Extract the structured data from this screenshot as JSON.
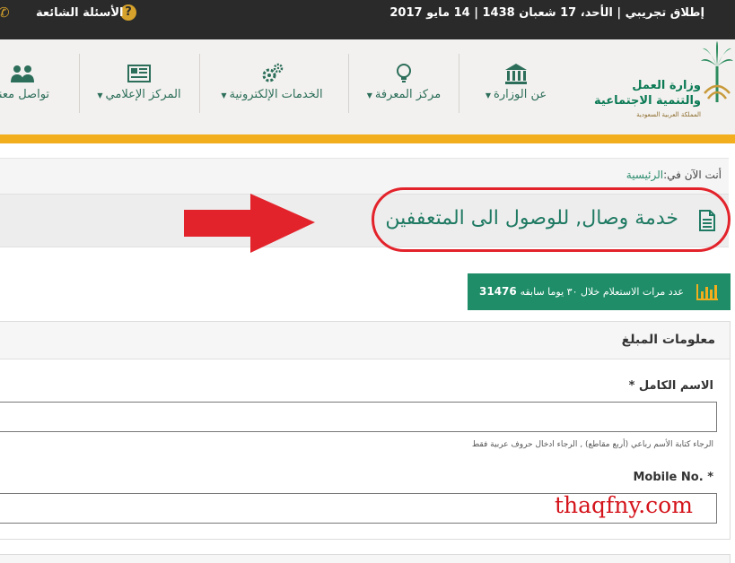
{
  "topbar": {
    "launch_text": "إطلاق تجريبي | الأحد، 17 شعبان 1438 | 14 مايو 2017",
    "faq_label": "الأسئلة الشائعة",
    "faq_icon": "question-circle-icon",
    "phone_icon": "phone-icon"
  },
  "logo": {
    "line1": "وزارة العمل",
    "line2": "والتنمية الاجتماعية",
    "line3": "المملكة العربية السعودية"
  },
  "nav": {
    "items": [
      {
        "label": "عن الوزارة",
        "icon": "ministry-building-icon",
        "dropdown": true
      },
      {
        "label": "مركز المعرفة",
        "icon": "lightbulb-icon",
        "dropdown": true
      },
      {
        "label": "الخدمات الإلكترونية",
        "icon": "gears-icon",
        "dropdown": true
      },
      {
        "label": "المركز الإعلامي",
        "icon": "newspaper-icon",
        "dropdown": true
      },
      {
        "label": "تواصل معنا",
        "icon": "users-icon",
        "dropdown": false
      }
    ]
  },
  "breadcrumb": {
    "prefix": "أنت الآن في:",
    "home": "الرئيسية"
  },
  "page": {
    "title": "خدمة وصال, للوصول الى المتعففين"
  },
  "counter": {
    "label": "عدد مرات الاستعلام خلال ٣٠ يوما سابقه",
    "value": "31476"
  },
  "form": {
    "section_title": "معلومات المبلغ",
    "full_name_label": "الاسم الكامل",
    "full_name_value": "",
    "full_name_help": "الرجاء كتابة الأسم رباعي (أربع مقاطع) , الرجاء ادخال حروف عربية فقط",
    "mobile_label": "Mobile No.",
    "mobile_value": "",
    "required_mark": "*"
  },
  "watermark": "thaqfny.com",
  "colors": {
    "topbar_bg": "#2a2a2a",
    "accent_gold": "#f2ae1c",
    "brand_green": "#1e8d68",
    "highlight_red": "#e3232b"
  }
}
